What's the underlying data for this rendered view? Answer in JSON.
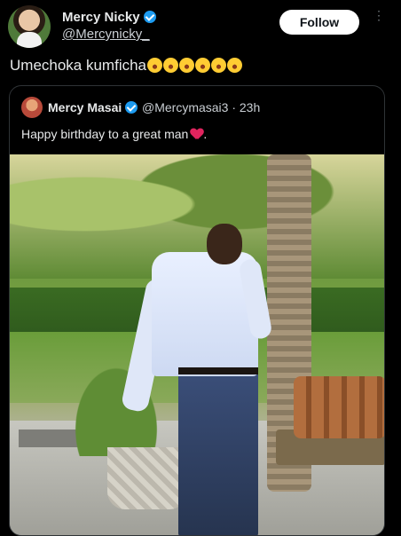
{
  "post": {
    "author_name": "Mercy Nicky",
    "handle": "@Mercynicky_",
    "follow_label": "Follow",
    "more_icon": "more-vertical-icon",
    "text": "Umechoka kumficha",
    "emoji_count": 6,
    "emoji_name": "rolling-on-floor-laughing-icon"
  },
  "quote": {
    "author_name": "Mercy Masai",
    "handle_time": "@Mercymasai3 · 23h",
    "text": "Happy birthday to a great man",
    "heart_emoji": "red-heart-icon",
    "trailing": "."
  },
  "colors": {
    "background": "#000000",
    "verified_blue": "#1d9bf0",
    "follow_bg": "#ffffff",
    "text_primary": "#e7e9ea"
  }
}
